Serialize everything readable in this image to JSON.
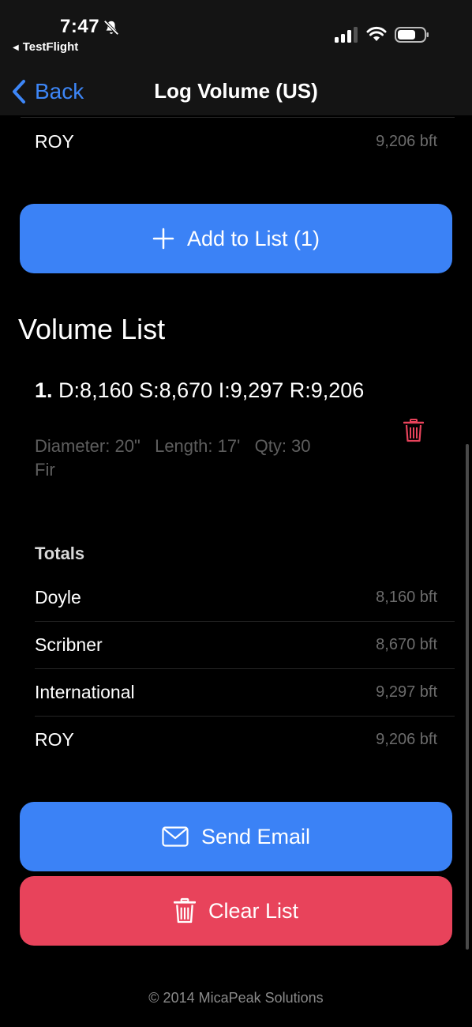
{
  "status_bar": {
    "time": "7:47",
    "back_app_label": "TestFlight",
    "icons": [
      "bell-slash-icon",
      "cellular-signal-icon",
      "wifi-icon",
      "battery-icon"
    ]
  },
  "nav": {
    "back_label": "Back",
    "title": "Log Volume (US)"
  },
  "top_row": {
    "label": "ROY",
    "value": "9,206 bft"
  },
  "add_button": {
    "label": "Add to List (1)",
    "icon": "plus-icon"
  },
  "volume_list": {
    "title": "Volume List",
    "entries": [
      {
        "index": "1.",
        "summary": "D:8,160 S:8,670 I:9,297 R:9,206",
        "details": "Diameter: 20\"   Length: 17'   Qty: 30",
        "species": "Fir",
        "delete_icon": "trash-icon"
      }
    ]
  },
  "totals": {
    "header": "Totals",
    "rows": [
      {
        "label": "Doyle",
        "value": "8,160 bft"
      },
      {
        "label": "Scribner",
        "value": "8,670 bft"
      },
      {
        "label": "International",
        "value": "9,297 bft"
      },
      {
        "label": "ROY",
        "value": "9,206 bft"
      }
    ]
  },
  "email_button": {
    "label": "Send Email",
    "icon": "envelope-icon"
  },
  "clear_button": {
    "label": "Clear List",
    "icon": "trash-icon"
  },
  "footer": {
    "copyright": "© 2014 MicaPeak Solutions"
  },
  "colors": {
    "accent_blue": "#3b82f6",
    "link_blue": "#3d86f7",
    "destructive_red": "#e8435b",
    "background": "#000000"
  }
}
